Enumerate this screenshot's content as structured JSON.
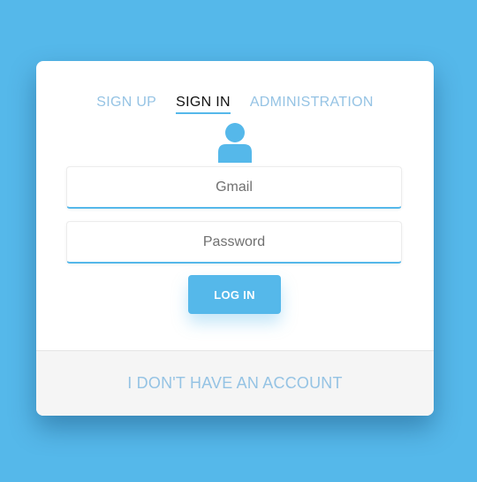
{
  "tabs": [
    {
      "label": "SIGN UP",
      "active": false
    },
    {
      "label": "SIGN IN",
      "active": true
    },
    {
      "label": "ADMINISTRATION",
      "active": false
    }
  ],
  "form": {
    "gmail_placeholder": "Gmail",
    "password_placeholder": "Password",
    "login_label": "LOG IN"
  },
  "footer": {
    "no_account_label": "I DON'T HAVE AN ACCOUNT"
  },
  "icons": {
    "user": "user-icon"
  },
  "colors": {
    "background": "#55b8ea",
    "accent": "#55b8ea",
    "tab_inactive": "#95c3e4",
    "tab_active": "#111111",
    "footer_bg": "#f5f5f5"
  }
}
